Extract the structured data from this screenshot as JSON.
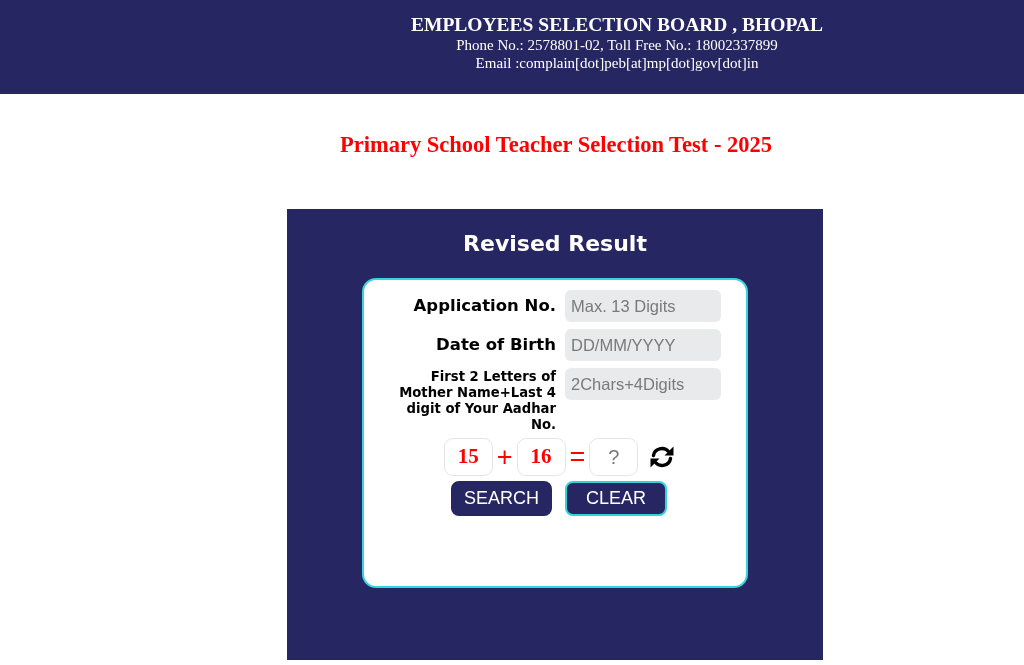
{
  "header": {
    "title": "EMPLOYEES SELECTION BOARD , BHOPAL",
    "phone": "Phone No.: 2578801-02, Toll Free No.: 18002337899",
    "email": "Email :complain[dot]peb[at]mp[dot]gov[dot]in"
  },
  "page_title": "Primary School Teacher Selection Test - 2025",
  "panel": {
    "heading": "Revised Result",
    "fields": [
      {
        "kind": "standard",
        "label": "Application No.",
        "placeholder": "Max. 13 Digits"
      },
      {
        "kind": "standard",
        "label": "Date of Birth",
        "placeholder": "DD/MM/YYYY"
      },
      {
        "kind": "compact",
        "label": "First 2 Letters of Mother Name+Last 4 digit of Your Aadhar No.",
        "placeholder": "2Chars+4Digits"
      }
    ],
    "captcha": {
      "first_number": "15",
      "operator": "+",
      "second_number": "16",
      "equals": "=",
      "answer_placeholder": "?"
    },
    "buttons": [
      {
        "label": "SEARCH",
        "focused": false
      },
      {
        "label": "CLEAR",
        "focused": true
      }
    ]
  }
}
